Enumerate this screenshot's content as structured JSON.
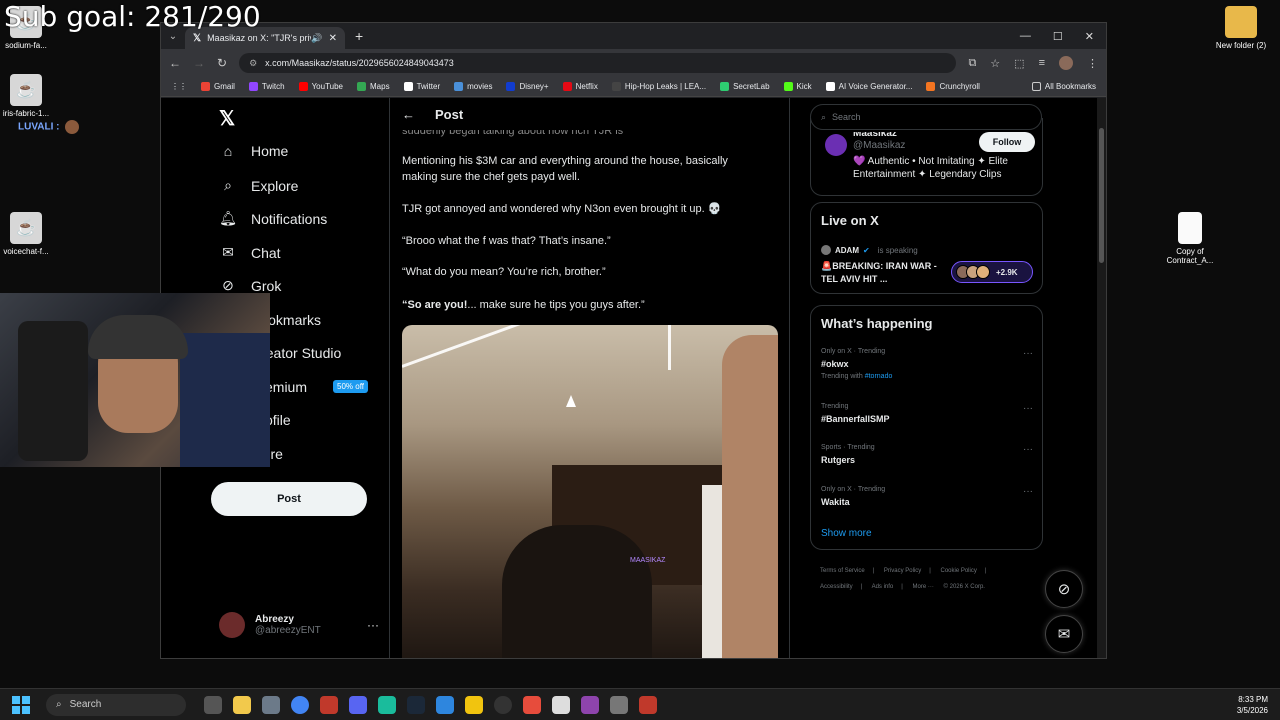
{
  "overlay": {
    "goal": "Sub goal: 281/290"
  },
  "desktop": {
    "icons": [
      {
        "label": "sodium-fa..."
      },
      {
        "label": "iris-fabric-1..."
      },
      {
        "label": "voicechat-f..."
      },
      {
        "label": "New folder (2)"
      },
      {
        "label": "Copy of Contract_A..."
      }
    ],
    "chat_user": "LUVALI :"
  },
  "browser": {
    "tab_title": "Maasikaz on X: \"TJR's privat",
    "url": "x.com/Maasikaz/status/2029656024849043473",
    "bookmarks": [
      "Gmail",
      "Twitch",
      "YouTube",
      "Maps",
      "Twitter",
      "movies",
      "Disney+",
      "Netflix",
      "Hip-Hop Leaks | LEA...",
      "SecretLab",
      "Kick",
      "AI Voice Generator...",
      "Crunchyroll"
    ],
    "all_bookmarks": "All Bookmarks"
  },
  "x_nav": {
    "items": [
      {
        "label": "Home",
        "icon": "home-icon"
      },
      {
        "label": "Explore",
        "icon": "search-icon"
      },
      {
        "label": "Notifications",
        "icon": "bell-icon"
      },
      {
        "label": "Chat",
        "icon": "mail-icon"
      },
      {
        "label": "Grok",
        "icon": "grok-icon"
      },
      {
        "label": "Bookmarks",
        "icon": "bookmark-icon"
      },
      {
        "label": "Creator Studio",
        "icon": "studio-icon"
      },
      {
        "label": "Premium",
        "icon": "x-icon"
      },
      {
        "label": "Profile",
        "icon": "person-icon"
      },
      {
        "label": "More",
        "icon": "more-icon"
      }
    ],
    "premium_badge": "50% off",
    "post_button": "Post",
    "account": {
      "name": "Abreezy",
      "handle": "@abreezyENT"
    }
  },
  "post": {
    "header": "Post",
    "cut_line": "suddenly began talking about how rich TJR is",
    "paragraphs": [
      "Mentioning his $3M car and everything around the house, basically making sure the chef gets payd well.",
      "TJR got annoyed and wondered why N3on even brought it up. 💀",
      "“Brooo what the f was that? That’s insane.”",
      "“What do you mean? You’re rich, brother.”"
    ],
    "last_bold": "“So are you!",
    "last_rest": "... make sure he tips you guys after.”",
    "watermark": "MAASIKAZ"
  },
  "sidebar": {
    "search_placeholder": "Search",
    "profile": {
      "name": "Maasikaz",
      "handle": "@Maasikaz",
      "bio": "💜 Authentic • Not Imitating ✦ Elite Entertainment ✦ Legendary Clips",
      "follow": "Follow"
    },
    "live": {
      "title": "Live on X",
      "host": "ADAM",
      "status": "is speaking",
      "text": "🚨BREAKING: IRAN WAR - TEL AVIV HIT ...",
      "count": "+2.9K"
    },
    "happening": {
      "title": "What’s happening",
      "trends": [
        {
          "meta": "Only on X · Trending",
          "name": "#okwx",
          "with_label": "Trending with",
          "with_tag": "#tornado"
        },
        {
          "meta": "Trending",
          "name": "#BannerfallSMP"
        },
        {
          "meta": "Sports · Trending",
          "name": "Rutgers"
        },
        {
          "meta": "Only on X · Trending",
          "name": "Wakita"
        }
      ],
      "show_more": "Show more"
    },
    "footer": [
      "Terms of Service",
      "|",
      "Privacy Policy",
      "|",
      "Cookie Policy",
      "|",
      "Accessibility",
      "|",
      "Ads info",
      "|",
      "More ···",
      "© 2026 X Corp."
    ]
  },
  "taskbar": {
    "search": "Search",
    "time": "8:33 PM",
    "date": "3/5/2026"
  }
}
